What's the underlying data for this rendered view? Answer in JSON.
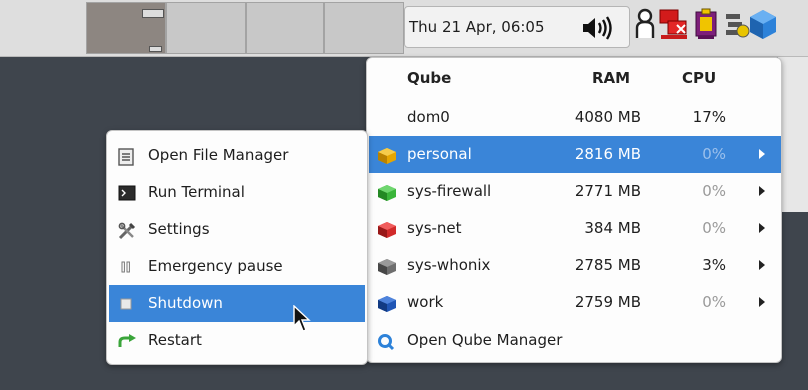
{
  "panel": {
    "clock": "Thu 21 Apr, 06:05",
    "tray_icons": [
      "speaker-icon",
      "user-icon",
      "network-disconnected-icon",
      "clipboard-icon",
      "updates-icon",
      "qubes-cube-icon"
    ]
  },
  "qube_menu": {
    "headers": {
      "qube": "Qube",
      "ram": "RAM",
      "cpu": "CPU"
    },
    "rows": [
      {
        "name": "dom0",
        "ram": "4080 MB",
        "cpu": "17%",
        "color": "#bfbfbf",
        "selected": false,
        "has_submenu": false
      },
      {
        "name": "personal",
        "ram": "2816 MB",
        "cpu": "0%",
        "color": "#e5a600",
        "selected": true,
        "has_submenu": true
      },
      {
        "name": "sys-firewall",
        "ram": "2771 MB",
        "cpu": "0%",
        "color": "#3ab53a",
        "selected": false,
        "has_submenu": true
      },
      {
        "name": "sys-net",
        "ram": "384 MB",
        "cpu": "0%",
        "color": "#d12a2a",
        "selected": false,
        "has_submenu": true
      },
      {
        "name": "sys-whonix",
        "ram": "2785 MB",
        "cpu": "3%",
        "color": "#6e6e6e",
        "selected": false,
        "has_submenu": true
      },
      {
        "name": "work",
        "ram": "2759 MB",
        "cpu": "0%",
        "color": "#1f55b5",
        "selected": false,
        "has_submenu": true
      }
    ],
    "open_manager": "Open Qube Manager"
  },
  "vm_menu": {
    "items": [
      {
        "label": "Open File Manager",
        "icon": "file-manager-icon"
      },
      {
        "label": "Run Terminal",
        "icon": "terminal-icon"
      },
      {
        "label": "Settings",
        "icon": "settings-tools-icon"
      },
      {
        "label": "Emergency pause",
        "icon": "pause-icon"
      },
      {
        "label": "Shutdown",
        "icon": "shutdown-icon"
      },
      {
        "label": "Restart",
        "icon": "restart-arrow-icon"
      }
    ]
  },
  "colors": {
    "selection": "#3a85d8",
    "desktop": "#3f454d",
    "panel": "#dedede"
  }
}
